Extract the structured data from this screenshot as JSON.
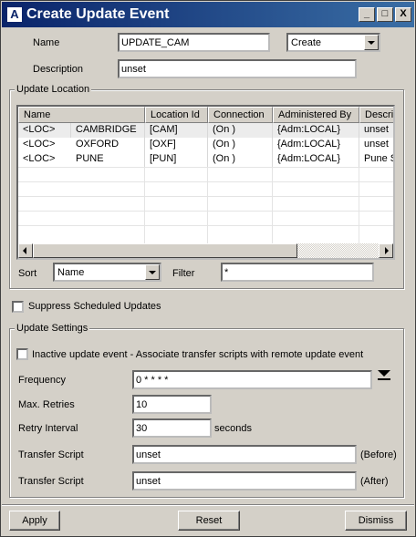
{
  "window": {
    "title": "Create Update Event",
    "icon_letter": "A",
    "minimize": "_",
    "maximize": "□",
    "close": "X"
  },
  "form": {
    "name_label": "Name",
    "name_value": "UPDATE_CAM",
    "mode_value": "Create",
    "description_label": "Description",
    "description_value": "unset"
  },
  "update_location": {
    "title": "Update Location",
    "columns": [
      "Name",
      "Location Id",
      "Connection",
      "Administered By",
      "Descrip"
    ],
    "rows": [
      {
        "loc": "<LOC>",
        "name": "CAMBRIDGE",
        "id": "[CAM]",
        "conn": "(On )",
        "admin": "{Adm:LOCAL}",
        "desc": "unset"
      },
      {
        "loc": "<LOC>",
        "name": "OXFORD",
        "id": "[OXF]",
        "conn": "(On )",
        "admin": "{Adm:LOCAL}",
        "desc": "unset"
      },
      {
        "loc": "<LOC>",
        "name": "PUNE",
        "id": "[PUN]",
        "conn": "(On )",
        "admin": "{Adm:LOCAL}",
        "desc": "Pune S"
      }
    ],
    "sort_label": "Sort",
    "sort_value": "Name",
    "filter_label": "Filter",
    "filter_value": "*"
  },
  "suppress_label": "Suppress Scheduled Updates",
  "settings": {
    "title": "Update Settings",
    "inactive_label": "Inactive update event - Associate transfer scripts with remote update event",
    "frequency_label": "Frequency",
    "frequency_value": "0 * * * *",
    "retries_label": "Max. Retries",
    "retries_value": "10",
    "interval_label": "Retry Interval",
    "interval_value": "30",
    "interval_unit": "seconds",
    "transfer_before_label": "Transfer Script",
    "transfer_before_value": "unset",
    "transfer_before_suffix": "(Before)",
    "transfer_after_label": "Transfer Script",
    "transfer_after_value": "unset",
    "transfer_after_suffix": "(After)"
  },
  "buttons": {
    "apply": "Apply",
    "reset": "Reset",
    "dismiss": "Dismiss"
  }
}
